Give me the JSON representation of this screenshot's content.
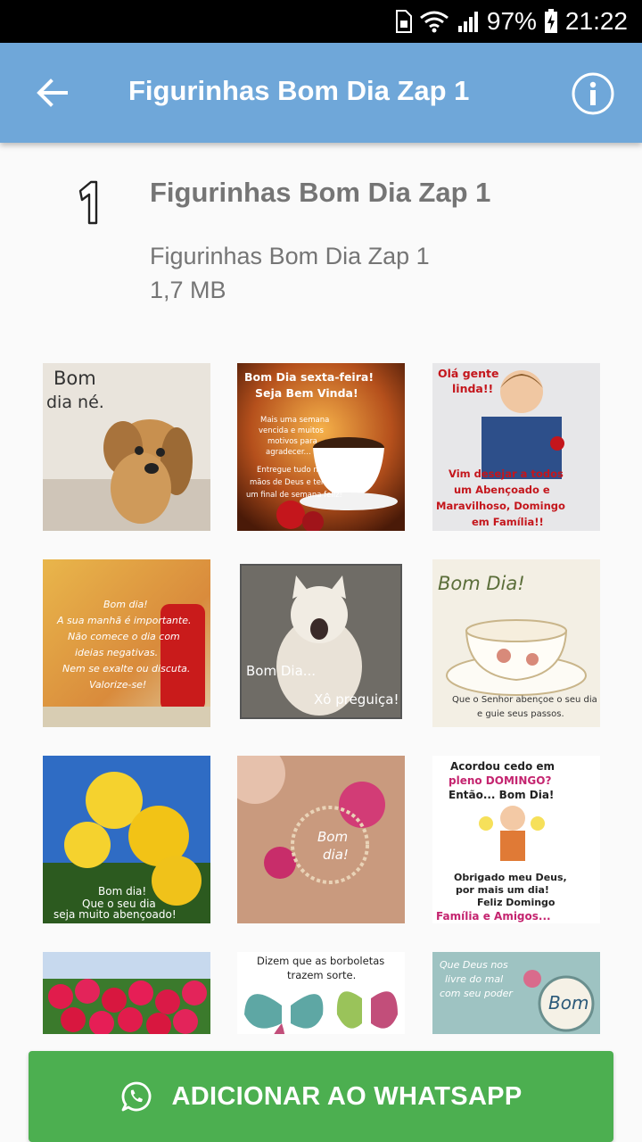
{
  "status_bar": {
    "battery": "97%",
    "time": "21:22"
  },
  "app_bar": {
    "title": "Figurinhas Bom Dia Zap 1"
  },
  "pack": {
    "tray_label": "1",
    "name": "Figurinhas Bom Dia Zap 1",
    "publisher": "Figurinhas Bom Dia Zap 1",
    "size": "1,7 MB"
  },
  "stickers": [
    {
      "lines": [
        "Bom",
        "dia né."
      ]
    },
    {
      "lines": [
        "Bom Dia sexta-feira!",
        "Seja Bem Vinda!",
        "Mais uma semana",
        "vencida e muitos",
        "motivos para",
        "agradecer...",
        "Entregue tudo nas",
        "mãos de Deus e tenha",
        "um final de semana feliz!"
      ]
    },
    {
      "lines": [
        "Olá gente",
        "linda!!",
        "Vim desejar a todos",
        "um Abençoado e",
        "Maravilhoso, Domingo",
        "em Família!!"
      ]
    },
    {
      "lines": [
        "Bom dia!",
        "A sua manhã é importante.",
        "Não comece o dia com",
        "ideias negativas.",
        "Nem se exalte ou discuta.",
        "Valorize-se!"
      ]
    },
    {
      "lines": [
        "Bom Dia...",
        "Xô preguiça!"
      ]
    },
    {
      "lines": [
        "Bom Dia!",
        "Que o Senhor abençoe o seu dia",
        "e guie seus passos."
      ]
    },
    {
      "lines": [
        "Bom dia!",
        "Que o seu dia",
        "seja muito abençoado!"
      ]
    },
    {
      "lines": [
        "Bom",
        "dia!"
      ]
    },
    {
      "lines": [
        "Acordou cedo em",
        "pleno DOMINGO?",
        "Então... Bom Dia!",
        "Obrigado meu Deus,",
        "por mais um dia!",
        "Feliz Domingo",
        "Família e Amigos..."
      ]
    },
    {
      "lines": []
    },
    {
      "lines": [
        "Dizem que as borboletas",
        "trazem sorte."
      ]
    },
    {
      "lines": [
        "Que Deus nos",
        "livre do mal",
        "com seu poder",
        "Bom"
      ]
    }
  ],
  "cta": {
    "label": "ADICIONAR AO WHATSAPP"
  },
  "colors": {
    "app_bar": "#6fa7d9",
    "cta": "#4caf50",
    "text_secondary": "#757575"
  }
}
